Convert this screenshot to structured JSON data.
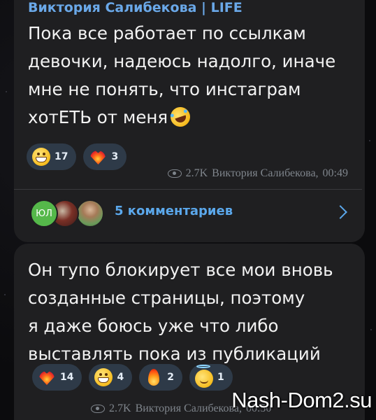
{
  "post_top": {
    "channel_name": "Виктория Салибекова | LIFE",
    "lines": [
      "Пока все работает по ссылкам",
      "девочки, надеюсь надолго, иначе",
      "мне не понять, что инстаграм",
      "хотЕТЬ от меня"
    ],
    "trailing_emoji": "rofl-emoji",
    "reactions": [
      {
        "icon": "grin-emoji",
        "count": "17"
      },
      {
        "icon": "heart-on-fire-emoji",
        "count": "3"
      }
    ],
    "views": "2.7K",
    "author": "Виктория Салибекова,",
    "time": "00:49"
  },
  "comments": {
    "avatar_initials": "ЮЛ",
    "label": "5 комментариев"
  },
  "post_bottom": {
    "lines": [
      "Он тупо блокирует все мои вновь",
      "созданные страницы, поэтому",
      "я даже боюсь уже что либо",
      "выставлять пока из публикаций"
    ],
    "reactions": [
      {
        "icon": "heart-on-fire-emoji",
        "count": "14"
      },
      {
        "icon": "grin-emoji",
        "count": "4"
      },
      {
        "icon": "fire-emoji",
        "count": "2"
      },
      {
        "icon": "halo-emoji",
        "count": "1"
      }
    ],
    "views": "2.7K",
    "author": "Виктория Салибекова,",
    "time": "00:50"
  },
  "watermark": "Nash-Dom2.su",
  "colors": {
    "bubble": "#1f1f21",
    "accent": "#5ba8ec",
    "reaction_bg": "#2e3a48",
    "meta_text": "#7f858c"
  }
}
